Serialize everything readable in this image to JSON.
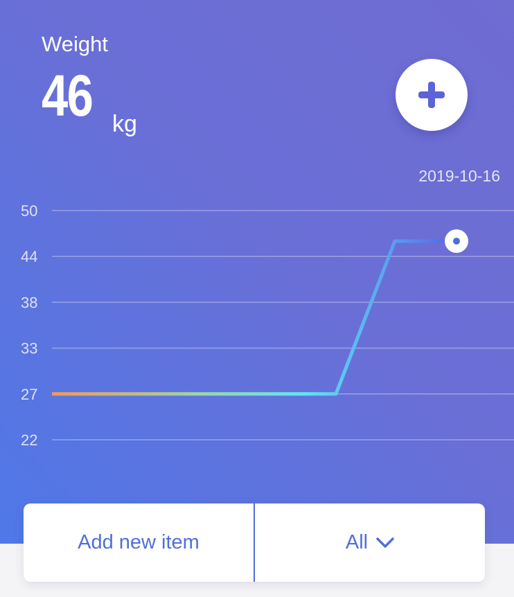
{
  "header": {
    "title": "Weight",
    "value": "46",
    "unit": "kg",
    "add_icon": "plus-icon"
  },
  "chart_meta": {
    "date": "2019-10-16"
  },
  "chart_data": {
    "type": "line",
    "title": "",
    "xlabel": "",
    "ylabel": "",
    "y_ticks": [
      "50",
      "44",
      "38",
      "33",
      "27",
      "22"
    ],
    "series": [
      {
        "values": [
          27,
          27,
          27,
          27,
          27,
          46,
          46
        ]
      }
    ],
    "highlight_last_point": true,
    "grid": true
  },
  "actions": {
    "add_item_label": "Add new item",
    "filter_label": "All",
    "filter_icon": "chevron-down-icon"
  },
  "colors": {
    "accent": "#4d6fdb",
    "gradient_start": "#f09a5a",
    "gradient_mid": "#5fe6f2",
    "gradient_end": "#5a4fe0"
  }
}
